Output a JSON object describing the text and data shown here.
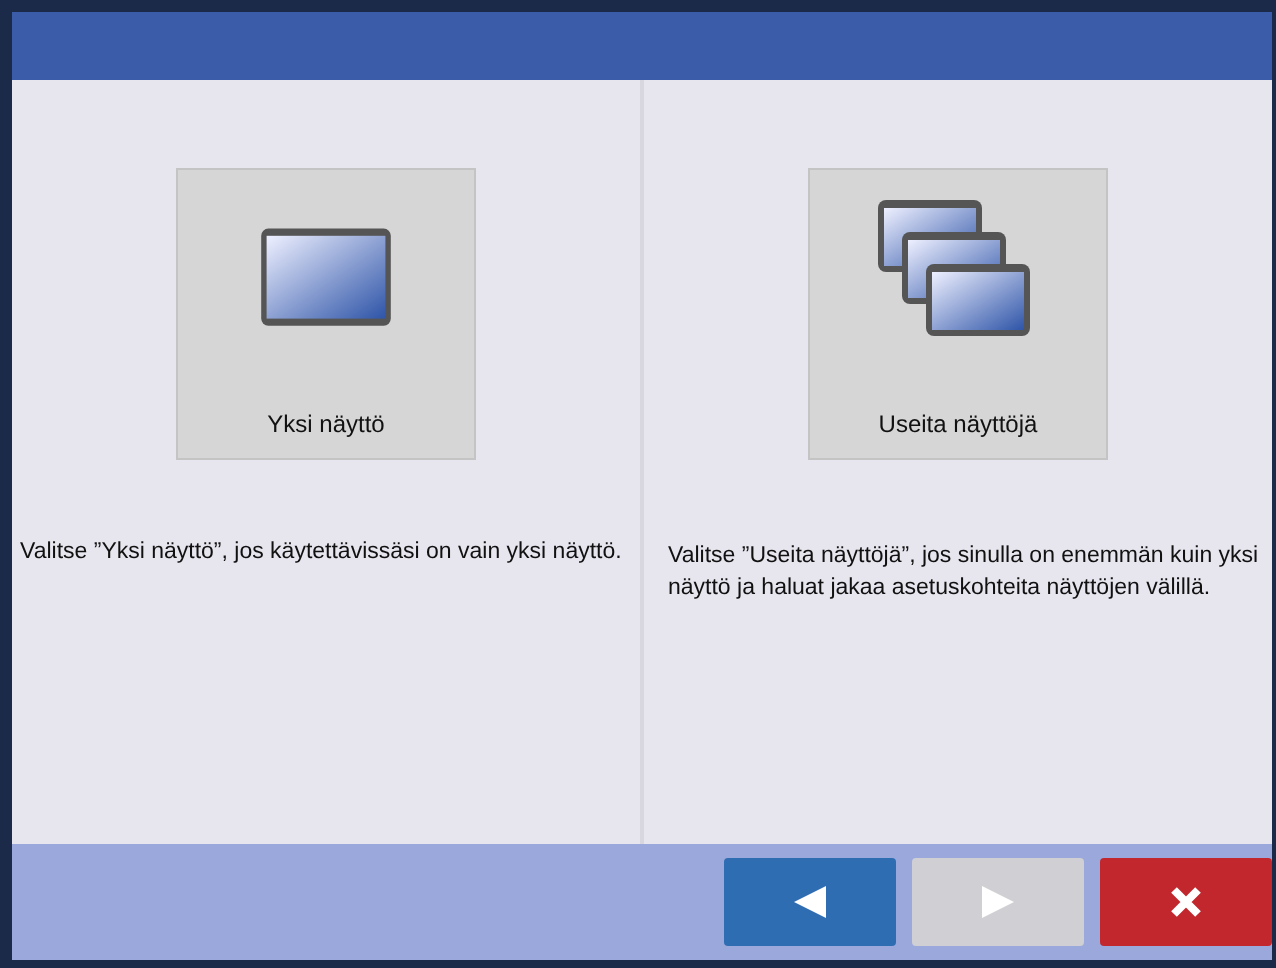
{
  "options": [
    {
      "kind": "single",
      "label": "Yksi näyttö",
      "description": "Valitse ”Yksi näyttö”, jos käytettävissäsi on vain yksi näyttö."
    },
    {
      "kind": "multiple",
      "label": "Useita näyttöjä",
      "description": "Valitse ”Useita näyttöjä”, jos sinulla on enemmän kuin yksi näyttö ja haluat jakaa asetuskohteita näyttöjen välillä."
    }
  ],
  "buttons": [
    {
      "kind": "back",
      "disabled": false
    },
    {
      "kind": "next",
      "disabled": true
    },
    {
      "kind": "cancel",
      "disabled": false
    }
  ]
}
